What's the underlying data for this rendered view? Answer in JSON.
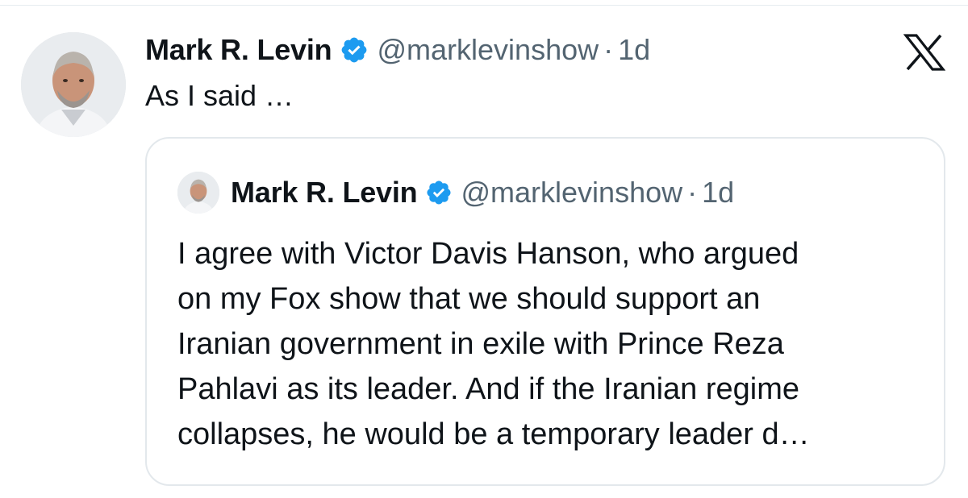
{
  "tweet": {
    "author_name": "Mark R. Levin",
    "handle": "@marklevinshow",
    "separator": "·",
    "time": "1d",
    "text": "As I said …",
    "verified_color": "#1d9bf0"
  },
  "quoted": {
    "author_name": "Mark R. Levin",
    "handle": "@marklevinshow",
    "separator": "·",
    "time": "1d",
    "lines": [
      "I agree with Victor Davis Hanson, who argued",
      "on my Fox show that we should support an",
      "Iranian government in exile with Prince Reza",
      "Pahlavi as its leader.  And if the Iranian regime",
      "collapses, he would be a temporary leader d…"
    ]
  },
  "icons": {
    "verified": "verified-badge-icon",
    "brand": "x-logo-icon"
  }
}
